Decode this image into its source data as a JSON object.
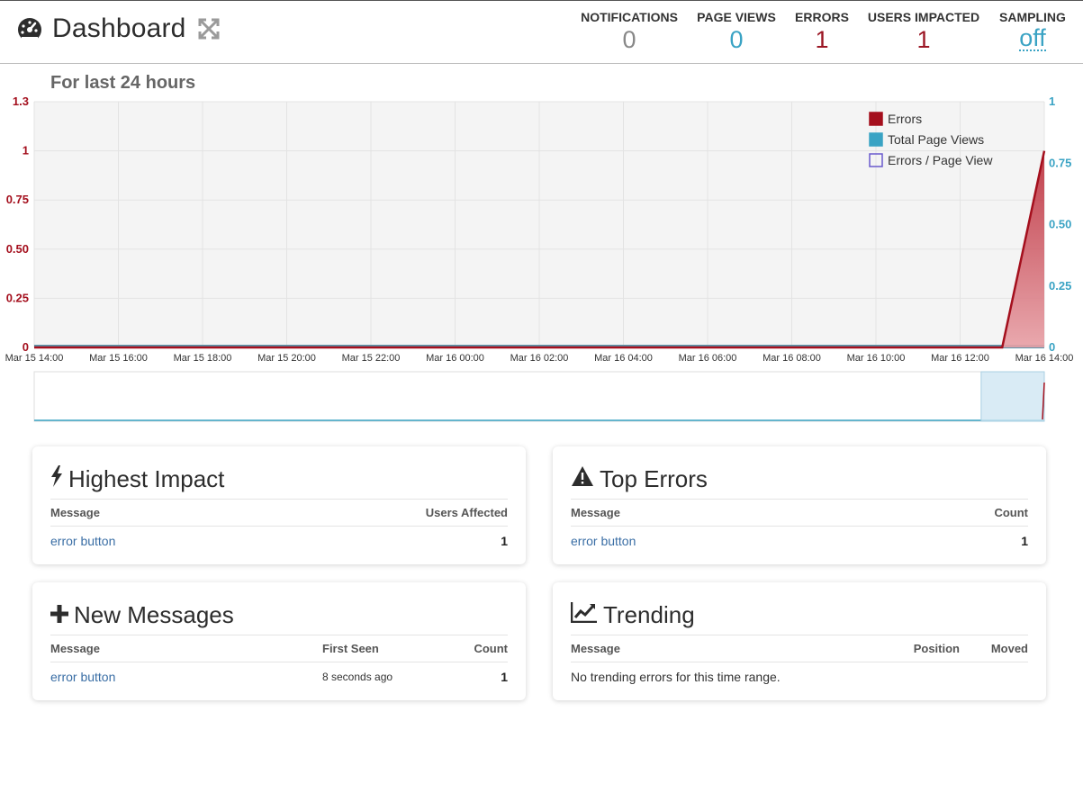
{
  "header": {
    "title": "Dashboard",
    "stats": {
      "notifications": {
        "label": "NOTIFICATIONS",
        "value": "0"
      },
      "page_views": {
        "label": "PAGE VIEWS",
        "value": "0"
      },
      "errors": {
        "label": "ERRORS",
        "value": "1"
      },
      "users_impacted": {
        "label": "USERS IMPACTED",
        "value": "1"
      },
      "sampling": {
        "label": "SAMPLING",
        "value": "off"
      }
    }
  },
  "colors": {
    "errors": "#a40f1d",
    "page_views": "#3aa3c4",
    "errors_per_view": "#6a5acd",
    "grid_bg": "#f4f4f4"
  },
  "chart_data": {
    "type": "area",
    "title": "For last 24 hours",
    "x_ticks": [
      "Mar 15 14:00",
      "Mar 15 16:00",
      "Mar 15 18:00",
      "Mar 15 20:00",
      "Mar 15 22:00",
      "Mar 16 00:00",
      "Mar 16 02:00",
      "Mar 16 04:00",
      "Mar 16 06:00",
      "Mar 16 08:00",
      "Mar 16 10:00",
      "Mar 16 12:00",
      "Mar 16 14:00"
    ],
    "x_hours": [
      0,
      2,
      4,
      6,
      8,
      10,
      12,
      14,
      16,
      18,
      20,
      22,
      24
    ],
    "y_left": {
      "ticks": [
        "0",
        "0.25",
        "0.50",
        "0.75",
        "1",
        "1.3"
      ],
      "values": [
        0,
        0.25,
        0.5,
        0.75,
        1,
        1.25
      ],
      "range": [
        0,
        1.25
      ]
    },
    "y_right": {
      "ticks": [
        "0",
        "0.25",
        "0.50",
        "0.75",
        "1"
      ],
      "values": [
        0,
        0.25,
        0.5,
        0.75,
        1
      ],
      "range": [
        0,
        1
      ]
    },
    "legend": [
      "Errors",
      "Total Page Views",
      "Errors / Page View"
    ],
    "legend_position": "top-right",
    "grid": true,
    "series": [
      {
        "name": "Errors",
        "axis": "left",
        "x": [
          0,
          23,
          24
        ],
        "y": [
          0,
          0,
          1
        ]
      },
      {
        "name": "Total Page Views",
        "axis": "right",
        "x": [
          0,
          24
        ],
        "y": [
          0,
          0
        ]
      },
      {
        "name": "Errors / Page View",
        "axis": "right",
        "x": [],
        "y": []
      }
    ],
    "navigator_selection": {
      "from_hour": 22.5,
      "to_hour": 24
    }
  },
  "cards": {
    "highest_impact": {
      "title": "Highest Impact",
      "columns": [
        "Message",
        "Users Affected"
      ],
      "rows": [
        {
          "message": "error button",
          "value": "1"
        }
      ]
    },
    "top_errors": {
      "title": "Top Errors",
      "columns": [
        "Message",
        "Count"
      ],
      "rows": [
        {
          "message": "error button",
          "value": "1"
        }
      ]
    },
    "new_messages": {
      "title": "New Messages",
      "columns": [
        "Message",
        "First Seen",
        "Count"
      ],
      "rows": [
        {
          "message": "error button",
          "first_seen": "8 seconds ago",
          "count": "1"
        }
      ]
    },
    "trending": {
      "title": "Trending",
      "columns": [
        "Message",
        "Position",
        "Moved"
      ],
      "empty": "No trending errors for this time range."
    }
  }
}
